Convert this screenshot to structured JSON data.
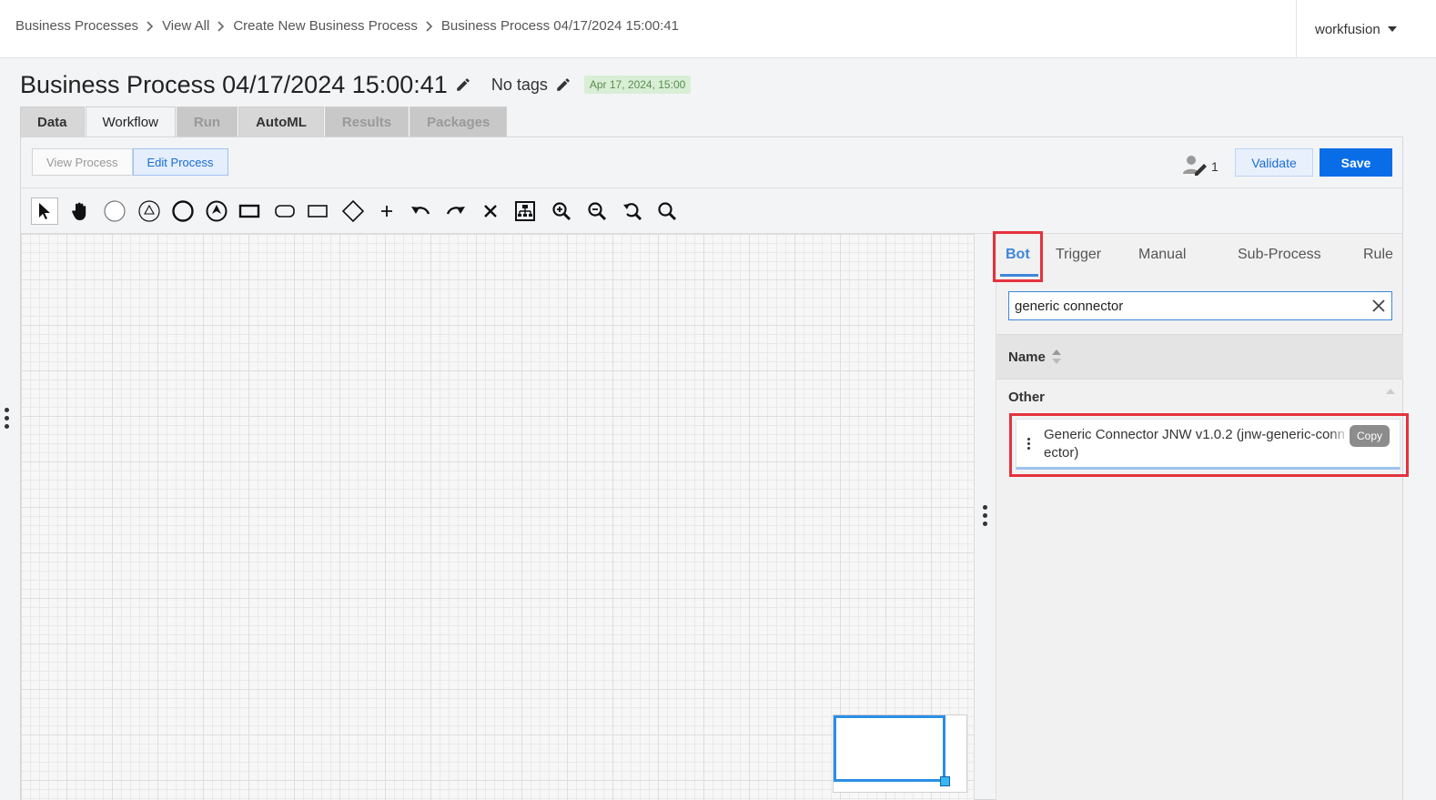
{
  "breadcrumb": [
    {
      "label": "Business Processes"
    },
    {
      "label": "View All"
    },
    {
      "label": "Create New Business Process"
    },
    {
      "label": "Business Process 04/17/2024 15:00:41"
    }
  ],
  "user": {
    "name": "workfusion"
  },
  "title": "Business Process 04/17/2024 15:00:41",
  "tags_label": "No tags",
  "date_badge": "Apr 17, 2024, 15:00",
  "tabs": [
    {
      "label": "Data",
      "state": "normal"
    },
    {
      "label": "Workflow",
      "state": "active"
    },
    {
      "label": "Run",
      "state": "disabled"
    },
    {
      "label": "AutoML",
      "state": "normal"
    },
    {
      "label": "Results",
      "state": "disabled"
    },
    {
      "label": "Packages",
      "state": "disabled"
    }
  ],
  "mode": {
    "view_label": "View Process",
    "edit_label": "Edit Process",
    "active": "edit"
  },
  "editors_count": "1",
  "actions": {
    "validate_label": "Validate",
    "save_label": "Save"
  },
  "tools": [
    "pointer-tool-icon",
    "hand-tool-icon",
    "start-event-icon",
    "intermediate-event-icon",
    "end-event-icon",
    "escalation-event-icon",
    "task-icon",
    "subprocess-icon",
    "data-object-icon",
    "gateway-icon",
    "add-icon",
    "undo-icon",
    "redo-icon",
    "delete-icon",
    "auto-layout-icon",
    "zoom-in-icon",
    "zoom-out-icon",
    "zoom-reset-icon",
    "zoom-fit-icon"
  ],
  "palette": {
    "tabs": [
      {
        "label": "Bot",
        "active": true
      },
      {
        "label": "Trigger"
      },
      {
        "label": "Manual"
      },
      {
        "label": "Sub-Process"
      },
      {
        "label": "Rule"
      }
    ],
    "search": {
      "value": "generic connector"
    },
    "column_header": "Name",
    "group": "Other",
    "items": [
      {
        "label": "Generic Connector JNW v1.0.2 (jnw-generic-connector)",
        "copy_label": "Copy"
      }
    ]
  },
  "colors": {
    "primary": "#0a6de8",
    "highlight": "#e5323d",
    "badge_bg": "#d8efd5"
  }
}
